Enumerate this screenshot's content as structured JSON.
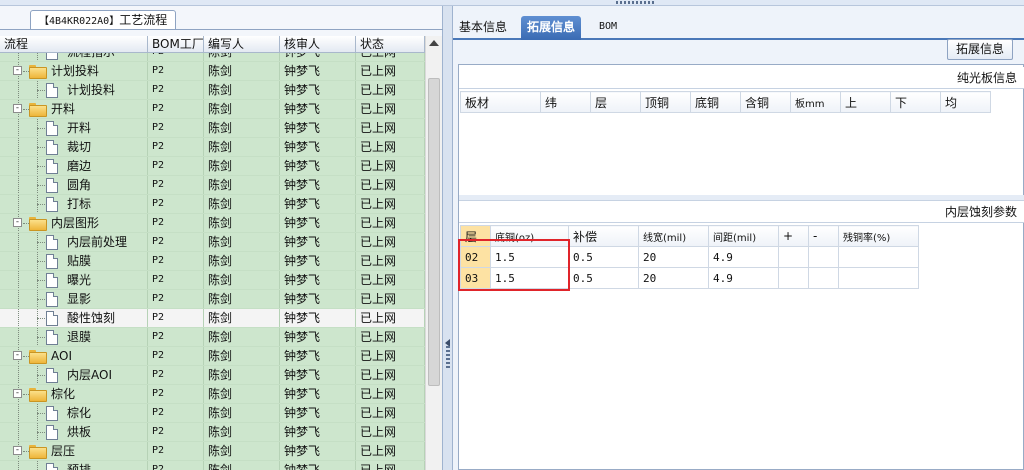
{
  "left_panel": {
    "tab_code": "【4B4KR022A0】",
    "tab_title": "工艺流程",
    "columns": {
      "name": "流程",
      "factory": "BOM工厂",
      "author": "编写人",
      "reviewer": "核审人",
      "status": "状态"
    },
    "rows": [
      {
        "name": "流程指示",
        "kind": "doc",
        "level": 1,
        "factory": "P2",
        "author": "陈剑",
        "reviewer": "钟梦飞",
        "status": "已上网"
      },
      {
        "name": "计划投料",
        "kind": "folder",
        "level": 0,
        "factory": "P2",
        "author": "陈剑",
        "reviewer": "钟梦飞",
        "status": "已上网"
      },
      {
        "name": "计划投料",
        "kind": "doc",
        "level": 1,
        "factory": "P2",
        "author": "陈剑",
        "reviewer": "钟梦飞",
        "status": "已上网"
      },
      {
        "name": "开料",
        "kind": "folder",
        "level": 0,
        "factory": "P2",
        "author": "陈剑",
        "reviewer": "钟梦飞",
        "status": "已上网"
      },
      {
        "name": "开料",
        "kind": "doc",
        "level": 1,
        "factory": "P2",
        "author": "陈剑",
        "reviewer": "钟梦飞",
        "status": "已上网"
      },
      {
        "name": "裁切",
        "kind": "doc",
        "level": 1,
        "factory": "P2",
        "author": "陈剑",
        "reviewer": "钟梦飞",
        "status": "已上网"
      },
      {
        "name": "磨边",
        "kind": "doc",
        "level": 1,
        "factory": "P2",
        "author": "陈剑",
        "reviewer": "钟梦飞",
        "status": "已上网"
      },
      {
        "name": "圆角",
        "kind": "doc",
        "level": 1,
        "factory": "P2",
        "author": "陈剑",
        "reviewer": "钟梦飞",
        "status": "已上网"
      },
      {
        "name": "打标",
        "kind": "doc",
        "level": 1,
        "factory": "P2",
        "author": "陈剑",
        "reviewer": "钟梦飞",
        "status": "已上网"
      },
      {
        "name": "内层图形",
        "kind": "folder",
        "level": 0,
        "factory": "P2",
        "author": "陈剑",
        "reviewer": "钟梦飞",
        "status": "已上网"
      },
      {
        "name": "内层前处理",
        "kind": "doc",
        "level": 1,
        "factory": "P2",
        "author": "陈剑",
        "reviewer": "钟梦飞",
        "status": "已上网"
      },
      {
        "name": "贴膜",
        "kind": "doc",
        "level": 1,
        "factory": "P2",
        "author": "陈剑",
        "reviewer": "钟梦飞",
        "status": "已上网"
      },
      {
        "name": "曝光",
        "kind": "doc",
        "level": 1,
        "factory": "P2",
        "author": "陈剑",
        "reviewer": "钟梦飞",
        "status": "已上网"
      },
      {
        "name": "显影",
        "kind": "doc",
        "level": 1,
        "factory": "P2",
        "author": "陈剑",
        "reviewer": "钟梦飞",
        "status": "已上网"
      },
      {
        "name": "酸性蚀刻",
        "kind": "doc",
        "level": 1,
        "factory": "P2",
        "author": "陈剑",
        "reviewer": "钟梦飞",
        "status": "已上网",
        "selected": true
      },
      {
        "name": "退膜",
        "kind": "doc",
        "level": 1,
        "factory": "P2",
        "author": "陈剑",
        "reviewer": "钟梦飞",
        "status": "已上网"
      },
      {
        "name": "AOI",
        "kind": "folder",
        "level": 0,
        "factory": "P2",
        "author": "陈剑",
        "reviewer": "钟梦飞",
        "status": "已上网"
      },
      {
        "name": "内层AOI",
        "kind": "doc",
        "level": 1,
        "factory": "P2",
        "author": "陈剑",
        "reviewer": "钟梦飞",
        "status": "已上网"
      },
      {
        "name": "棕化",
        "kind": "folder",
        "level": 0,
        "factory": "P2",
        "author": "陈剑",
        "reviewer": "钟梦飞",
        "status": "已上网"
      },
      {
        "name": "棕化",
        "kind": "doc",
        "level": 1,
        "factory": "P2",
        "author": "陈剑",
        "reviewer": "钟梦飞",
        "status": "已上网"
      },
      {
        "name": "烘板",
        "kind": "doc",
        "level": 1,
        "factory": "P2",
        "author": "陈剑",
        "reviewer": "钟梦飞",
        "status": "已上网"
      },
      {
        "name": "层压",
        "kind": "folder",
        "level": 0,
        "factory": "P2",
        "author": "陈剑",
        "reviewer": "钟梦飞",
        "status": "已上网"
      },
      {
        "name": "预排",
        "kind": "doc",
        "level": 1,
        "factory": "P2",
        "author": "陈剑",
        "reviewer": "钟梦飞",
        "status": "已上网"
      }
    ]
  },
  "right_panel": {
    "tabs": [
      "基本信息",
      "拓展信息",
      "BOM"
    ],
    "active_tab": "拓展信息",
    "ext_button": "拓展信息",
    "plain_board": {
      "title": "纯光板信息",
      "columns": [
        "板材",
        "纬",
        "层",
        "顶铜",
        "底铜",
        "含铜",
        "板mm",
        "上",
        "下",
        "均"
      ]
    },
    "inner_etch": {
      "title": "内层蚀刻参数",
      "columns": [
        "层",
        "底铜(oz)",
        "补偿",
        "线宽(mil)",
        "间距(mil)",
        "+",
        "-",
        "残铜率(%)"
      ],
      "rows": [
        [
          "02",
          "1.5",
          "0.5",
          "20",
          "4.9",
          "",
          "",
          ""
        ],
        [
          "03",
          "1.5",
          "0.5",
          "20",
          "4.9",
          "",
          "",
          ""
        ]
      ]
    }
  },
  "colors": {
    "grid_row": "#cde6cd",
    "active_tab": "#3a6bb3",
    "highlight_box": "#e0242a",
    "layer_header": "#fde2a3"
  }
}
